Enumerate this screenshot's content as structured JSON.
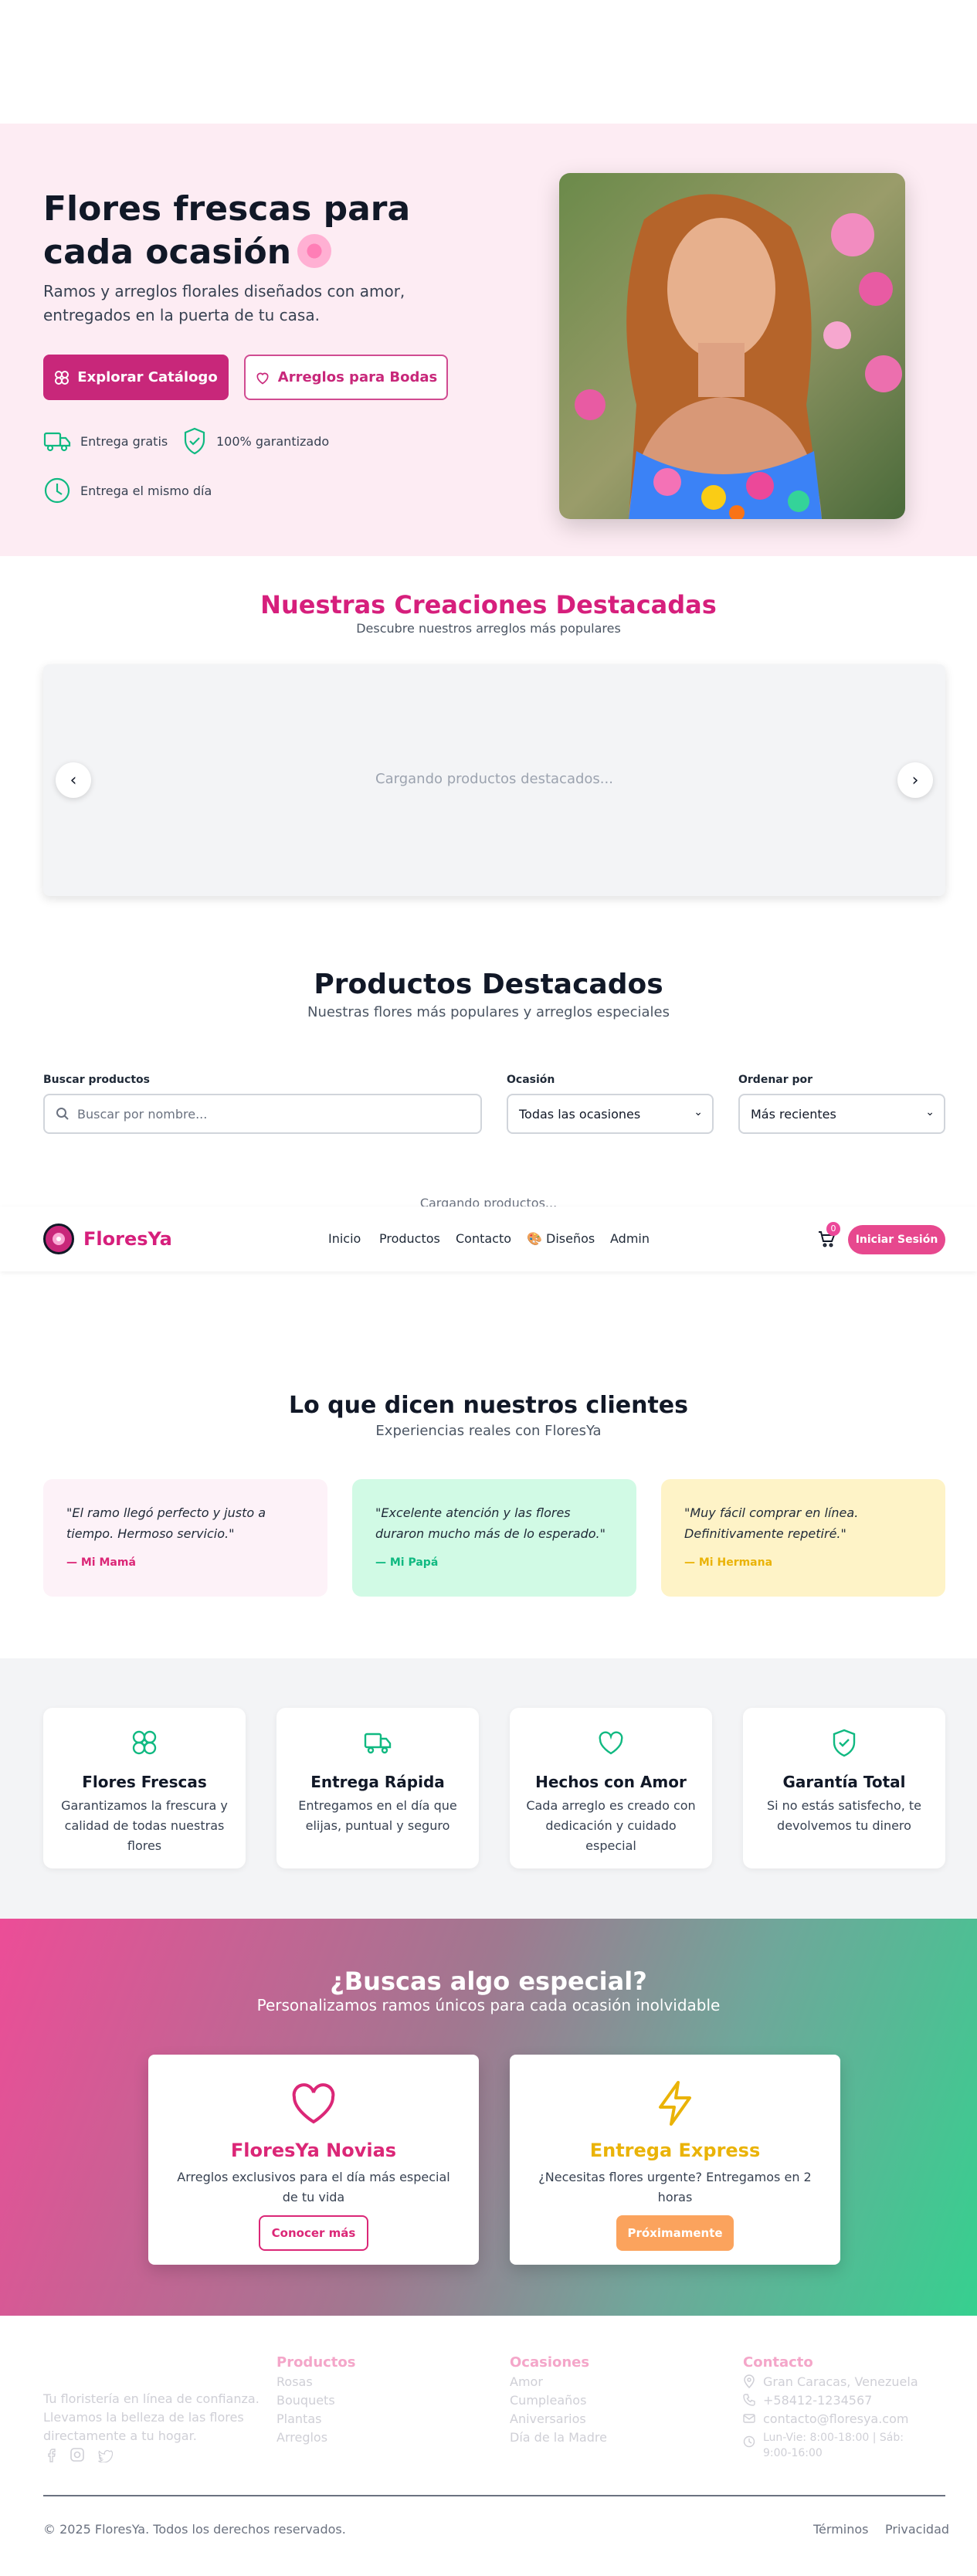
{
  "hero": {
    "title": "Flores frescas para cada ocasión",
    "subtitle": "Ramos y arreglos florales diseñados con amor, entregados en la puerta de tu casa.",
    "cta_primary": "Explorar Catálogo",
    "cta_secondary": "Arreglos para Bodas",
    "features": [
      "Entrega gratis",
      "100% garantizado",
      "Entrega el mismo día"
    ]
  },
  "creations": {
    "title": "Nuestras Creaciones Destacadas",
    "subtitle": "Descubre nuestros arreglos más populares",
    "loading": "Cargando productos destacados...",
    "prev": "‹",
    "next": "›"
  },
  "products": {
    "title": "Productos Destacados",
    "subtitle": "Nuestras flores más populares y arreglos especiales",
    "search_label": "Buscar productos",
    "search_placeholder": "Buscar por nombre...",
    "occasion_label": "Ocasión",
    "occasion_value": "Todas las ocasiones",
    "sort_label": "Ordenar por",
    "sort_value": "Más recientes",
    "loading": "Cargando productos..."
  },
  "nav": {
    "brand": "FloresYa",
    "items": [
      "Inicio",
      "Productos",
      "Contacto",
      "🎨 Diseños",
      "Admin"
    ],
    "cart_count": "0",
    "login": "Iniciar Sesión"
  },
  "testimonials": {
    "title": "Lo que dicen nuestros clientes",
    "subtitle": "Experiencias reales con FloresYa",
    "items": [
      {
        "quote": "\"El ramo llegó perfecto y justo a tiempo. Hermoso servicio.\"",
        "author": "— Mi Mamá",
        "bg": "#fdf2f8",
        "color": "#db2777"
      },
      {
        "quote": "\"Excelente atención y las flores duraron mucho más de lo esperado.\"",
        "author": "— Mi Papá",
        "bg": "#d1fae5",
        "color": "#10b981"
      },
      {
        "quote": "\"Muy fácil comprar en línea. Definitivamente repetiré.\"",
        "author": "— Mi Hermana",
        "bg": "#fef3c7",
        "color": "#eab308"
      }
    ]
  },
  "features": [
    {
      "title": "Flores Frescas",
      "desc": "Garantizamos la frescura y calidad de todas nuestras flores",
      "icon": "flower-icon"
    },
    {
      "title": "Entrega Rápida",
      "desc": "Entregamos en el día que elijas, puntual y seguro",
      "icon": "truck-icon"
    },
    {
      "title": "Hechos con Amor",
      "desc": "Cada arreglo es creado con dedicación y cuidado especial",
      "icon": "heart-icon"
    },
    {
      "title": "Garantía Total",
      "desc": "Si no estás satisfecho, te devolvemos tu dinero",
      "icon": "shield-check-icon"
    }
  ],
  "special": {
    "title": "¿Buscas algo especial?",
    "subtitle": "Personalizamos ramos únicos para cada ocasión inolvidable",
    "cards": [
      {
        "title": "FloresYa Novias",
        "desc": "Arreglos exclusivos para el día más especial de tu vida",
        "button": "Conocer más",
        "color": "#db2777"
      },
      {
        "title": "Entrega Express",
        "desc": "¿Necesitas flores urgente? Entregamos en 2 horas",
        "button": "Próximamente",
        "color": "#eab308"
      }
    ]
  },
  "footer": {
    "description": "Tu floristería en línea de confianza. Llevamos la belleza de las flores directamente a tu hogar.",
    "products_head": "Productos",
    "products": [
      "Rosas",
      "Bouquets",
      "Plantas",
      "Arreglos"
    ],
    "occasions_head": "Ocasiones",
    "occasions": [
      "Amor",
      "Cumpleaños",
      "Aniversarios",
      "Día de la Madre"
    ],
    "contact_head": "Contacto",
    "contact": {
      "address": "Gran Caracas, Venezuela",
      "phone": "+58412-1234567",
      "email": "contacto@floresya.com",
      "hours": "Lun-Vie: 8:00-18:00 | Sáb: 9:00-16:00"
    },
    "copyright": "© 2025 FloresYa. Todos los derechos reservados.",
    "terms": "Términos",
    "privacy": "Privacidad"
  },
  "colors": {
    "brand_pink": "#d61f7c",
    "button_pink": "#c8277a",
    "green": "#10b981"
  }
}
